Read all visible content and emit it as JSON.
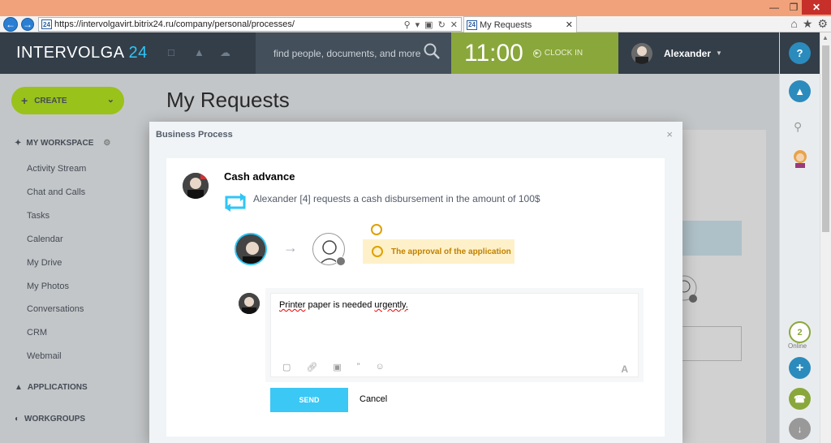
{
  "browser": {
    "url": "https://intervolgavirt.bitrix24.ru/company/personal/processes/",
    "favicon_text": "24",
    "tab_title": "My Requests"
  },
  "header": {
    "logo_main": "INTERVOLGA",
    "logo_num": "24",
    "search_placeholder": "find people, documents, and more",
    "clock_time": "11:00",
    "clock_in_label": "CLOCK IN",
    "user_name": "Alexander"
  },
  "right_panel": {
    "help_label": "?",
    "online_count": "2",
    "online_label": "Online"
  },
  "sidebar": {
    "create_label": "CREATE",
    "my_workspace": "MY WORKSPACE",
    "items": [
      "Activity Stream",
      "Chat and Calls",
      "Tasks",
      "Calendar",
      "My Drive",
      "My Photos",
      "Conversations",
      "CRM",
      "Webmail"
    ],
    "applications": "APPLICATIONS",
    "workgroups": "WORKGROUPS"
  },
  "main": {
    "page_title": "My Requests"
  },
  "modal": {
    "title": "Business Process",
    "close": "×",
    "request_title": "Cash advance",
    "request_desc": "Alexander [4] requests a cash disbursement in the amount of 100$",
    "approval_status": "The approval of the application",
    "comment_part1": "Printer",
    "comment_part2": " paper is needed ",
    "comment_part3": "urgently.",
    "send_label": "SEND",
    "cancel_label": "Cancel",
    "format_label": "A"
  },
  "colors": {
    "accent_blue": "#2fc6f6",
    "create_green": "#bbed21",
    "clock_green": "#8aa73b",
    "header_dark": "#333e49",
    "approval_bg": "#fef1c9"
  }
}
